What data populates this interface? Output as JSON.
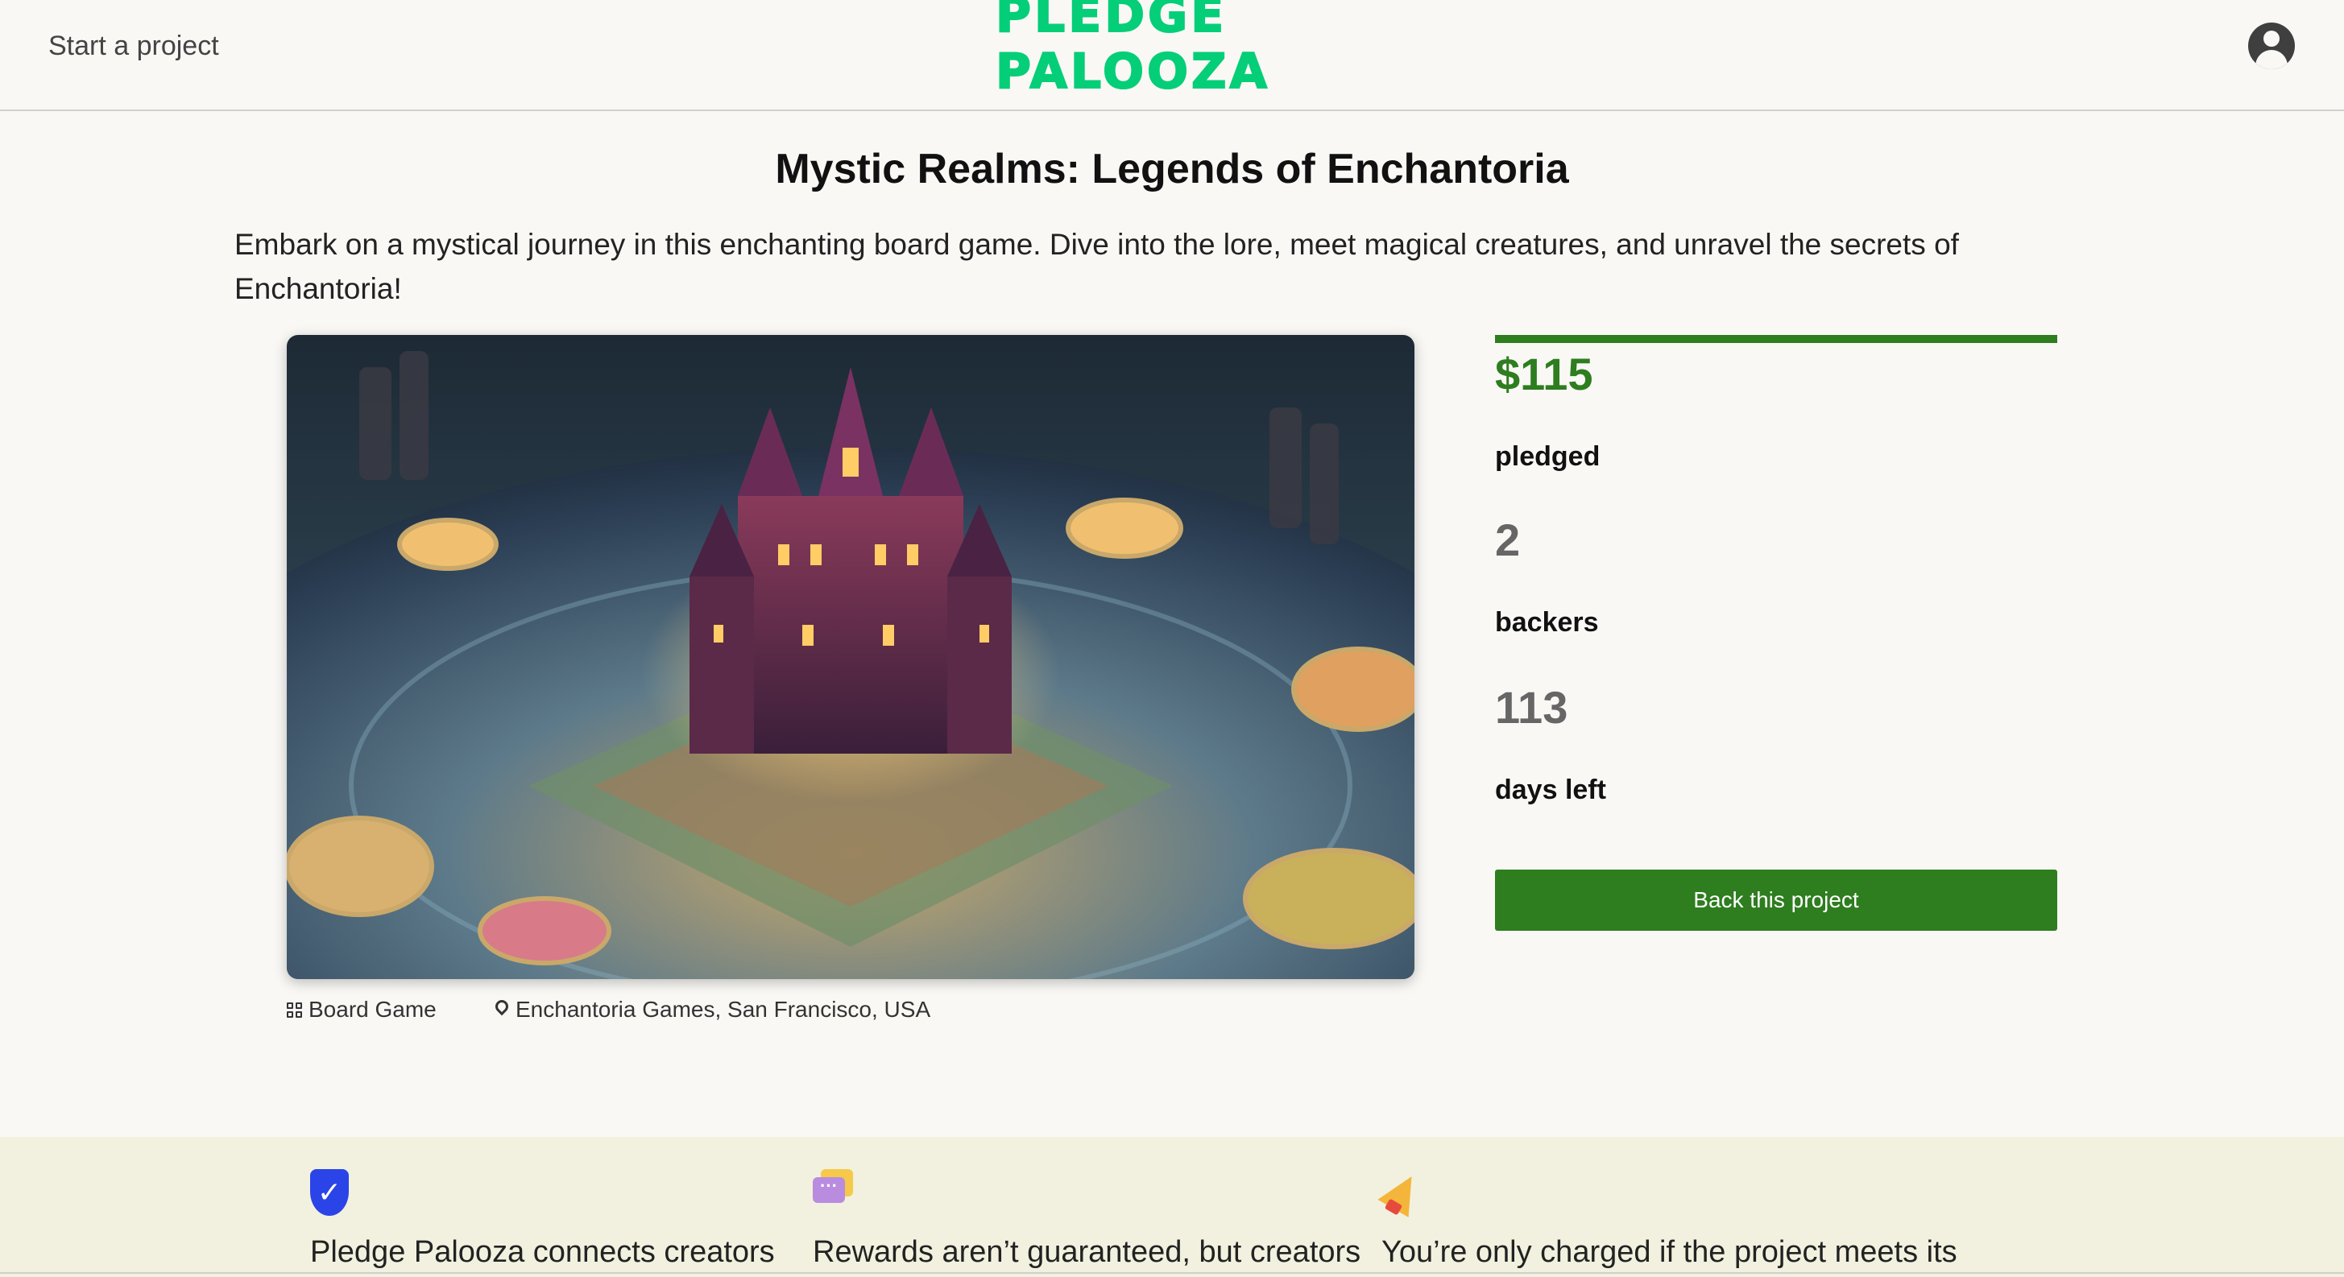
{
  "nav": {
    "start_project": "Start a project",
    "logo_text": "Pledge Palooza",
    "brand_color": "#05ce78"
  },
  "project": {
    "title": "Mystic Realms: Legends of Enchantoria",
    "description": "Embark on a mystical journey in this enchanting board game. Dive into the lore, meet magical creatures, and unravel the secrets of Enchantoria!",
    "image_alt": "Fantasy board game with a castle in the center",
    "category": "Board Game",
    "location": "Enchantoria Games, San Francisco, USA"
  },
  "stats": {
    "pledged_amount": "$115",
    "pledged_label": "pledged",
    "backers_count": "2",
    "backers_label": "backers",
    "days_left": "113",
    "days_left_label": "days left",
    "funding_progress_percent": 100,
    "accent_color": "#2e7d1f"
  },
  "actions": {
    "back_project": "Back this project"
  },
  "promises": [
    {
      "icon": "shield-check-icon",
      "text": "Pledge Palooza connects creators"
    },
    {
      "icon": "chat-bubbles-icon",
      "text": "Rewards aren’t guaranteed, but creators"
    },
    {
      "icon": "megaphone-icon",
      "text": "You’re only charged if the project meets its"
    }
  ]
}
